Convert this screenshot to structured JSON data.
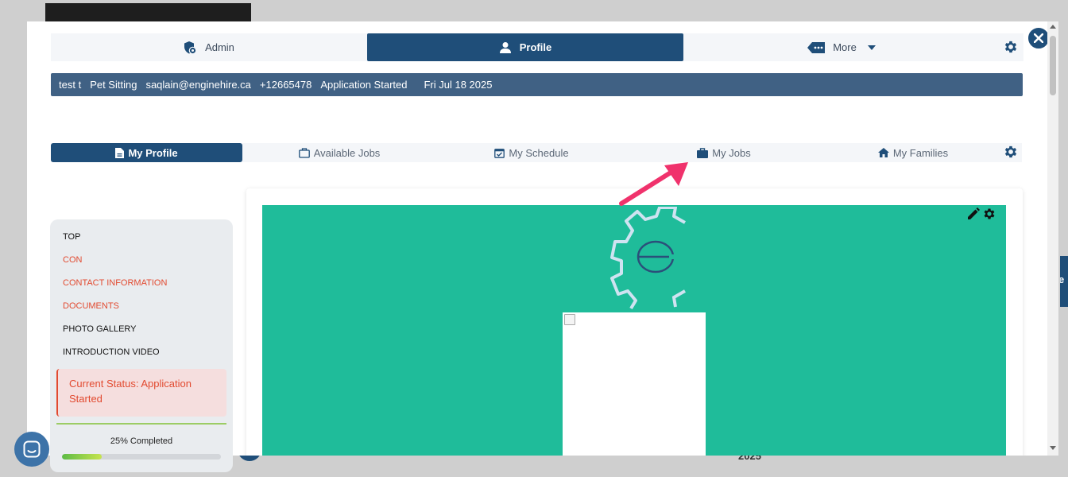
{
  "background": {
    "year_fragment": "2025",
    "side_tab_fragment": "e"
  },
  "top_tabs": [
    {
      "label": "Admin",
      "icon": "shield-gear-icon"
    },
    {
      "label": "Profile",
      "icon": "user-icon",
      "active": true
    },
    {
      "label": "More",
      "icon": "tag-dots-icon"
    }
  ],
  "info_bar": {
    "name": "test t",
    "service": "Pet Sitting",
    "email": "saqlain@enginehire.ca",
    "phone": "+12665478",
    "status": "Application Started",
    "date": "Fri Jul 18 2025"
  },
  "sub_tabs": [
    {
      "label": "My Profile",
      "icon": "document-icon",
      "active": true
    },
    {
      "label": "Available Jobs",
      "icon": "briefcase-outline-icon"
    },
    {
      "label": "My Schedule",
      "icon": "calendar-check-icon"
    },
    {
      "label": "My Jobs",
      "icon": "briefcase-icon"
    },
    {
      "label": "My Families",
      "icon": "home-icon"
    }
  ],
  "side_nav": {
    "items": [
      {
        "label": "TOP",
        "warn": false
      },
      {
        "label": "CON",
        "warn": true
      },
      {
        "label": "CONTACT INFORMATION",
        "warn": true
      },
      {
        "label": "DOCUMENTS",
        "warn": true
      },
      {
        "label": "PHOTO GALLERY",
        "warn": false
      },
      {
        "label": "INTRODUCTION VIDEO",
        "warn": false
      }
    ],
    "status_text": "Current Status: Application Started",
    "progress_label": "25% Completed",
    "progress_percent": 25
  },
  "colors": {
    "primary": "#1f4e79",
    "info_bar": "#406184",
    "banner": "#1fbc9a",
    "warn": "#e24a30",
    "arrow": "#f0326c"
  }
}
